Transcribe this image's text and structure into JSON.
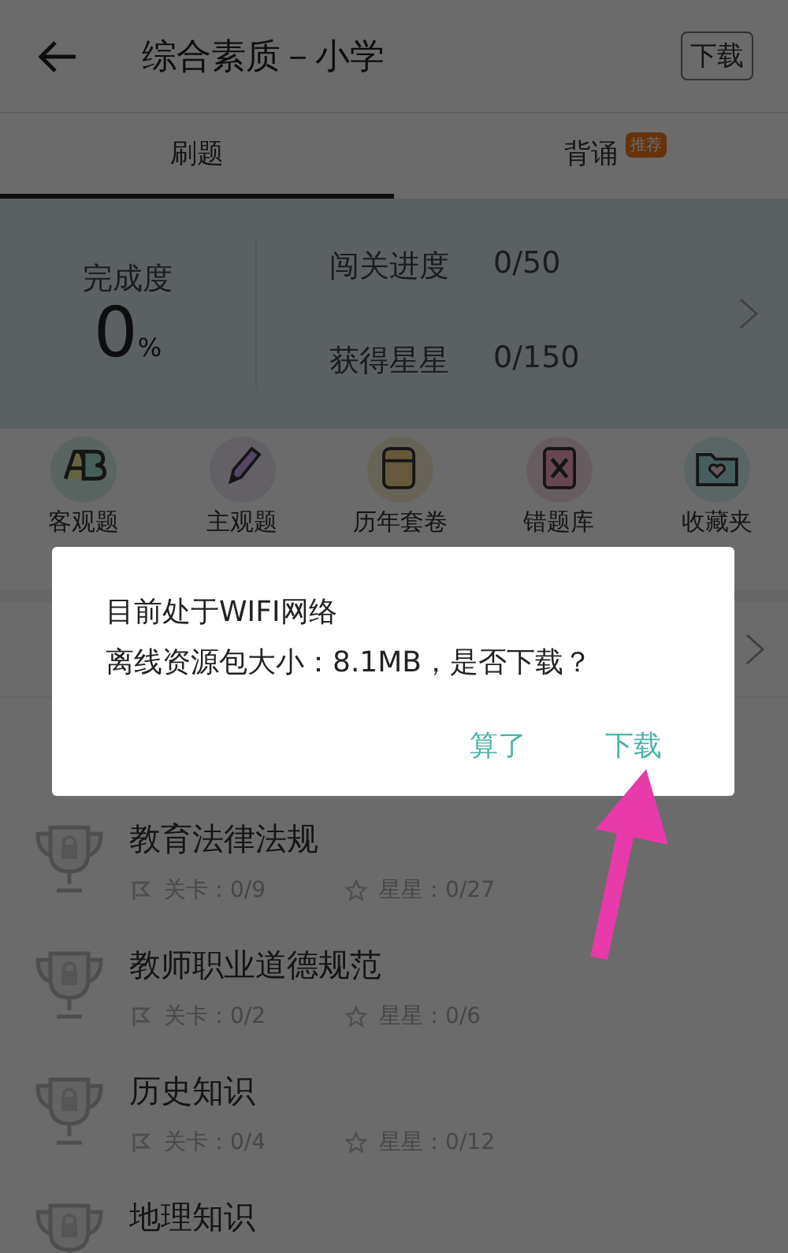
{
  "header": {
    "title": "综合素质－小学",
    "download_button": "下载"
  },
  "tabs": [
    {
      "label": "刷题",
      "selected": true
    },
    {
      "label": "背诵",
      "selected": false,
      "badge": "推荐"
    }
  ],
  "stats": {
    "completion_label": "完成度",
    "completion_value": "0",
    "completion_unit": "%",
    "rows": [
      {
        "label": "闯关进度",
        "value": "0/50"
      },
      {
        "label": "获得星星",
        "value": "0/150"
      }
    ]
  },
  "quick_links": [
    {
      "label": "客观题",
      "kind": "ab"
    },
    {
      "label": "主观题",
      "kind": "pencil"
    },
    {
      "label": "历年套卷",
      "kind": "paper"
    },
    {
      "label": "错题库",
      "kind": "mistake"
    },
    {
      "label": "收藏夹",
      "kind": "folder"
    }
  ],
  "levels": [
    {
      "title": "教育法律法规",
      "stages": "关卡：0/9",
      "star_count": "星星：0/27"
    },
    {
      "title": "教师职业道德规范",
      "stages": "关卡：0/2",
      "star_count": "星星：0/6"
    },
    {
      "title": "历史知识",
      "stages": "关卡：0/4",
      "star_count": "星星：0/12"
    },
    {
      "title": "地理知识"
    }
  ],
  "dialog": {
    "lines": [
      "目前处于WIFI网络",
      "离线资源包大小：8.1MB，是否下载？"
    ],
    "buttons": [
      "算了",
      "下载"
    ]
  }
}
